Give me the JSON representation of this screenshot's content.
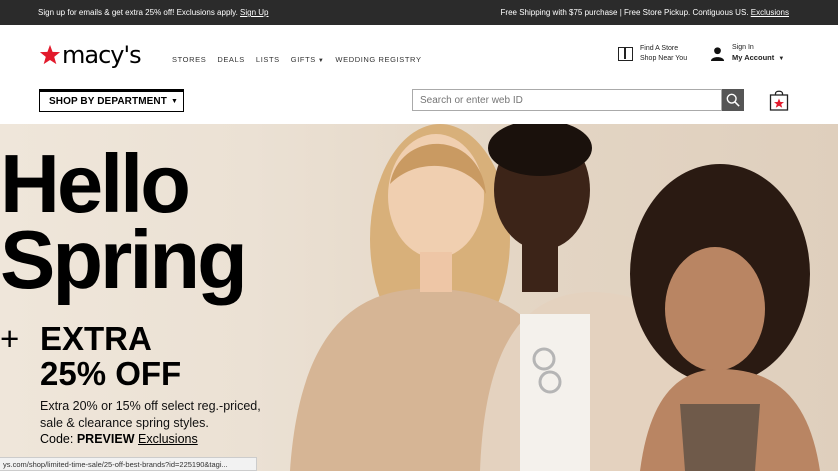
{
  "promo": {
    "left_text": "Sign up for emails & get extra 25% off! Exclusions apply.",
    "left_link": "Sign Up",
    "right_text": "Free Shipping with $75 purchase | Free Store Pickup. Contiguous US.",
    "right_link": "Exclusions"
  },
  "header": {
    "logo_text": "macy's",
    "nav": [
      "STORES",
      "DEALS",
      "LISTS",
      "GIFTS",
      "WEDDING REGISTRY"
    ],
    "store_line1": "Find A Store",
    "store_line2": "Shop Near You",
    "account_line1": "Sign In",
    "account_line2": "My Account",
    "department_label": "SHOP BY DEPARTMENT",
    "search_placeholder": "Search or enter web ID"
  },
  "hero": {
    "title_line1": "Hello",
    "title_line2": "Spring",
    "plus": "+",
    "extra_line1": "EXTRA",
    "extra_line2": "25% OFF",
    "sub_line1": "Extra 20% or 15% off select reg.-priced,",
    "sub_line2": "sale & clearance spring styles.",
    "code_label": "Code:",
    "code_value": "PREVIEW",
    "exclusions": "Exclusions"
  },
  "status_url": "ys.com/shop/limited-time-sale/25-off-best-brands?id=225190&tagi...",
  "colors": {
    "brand_red": "#e21a2c",
    "promo_bg": "#2b2b2b",
    "hero_bg": "#ebe1d4"
  }
}
